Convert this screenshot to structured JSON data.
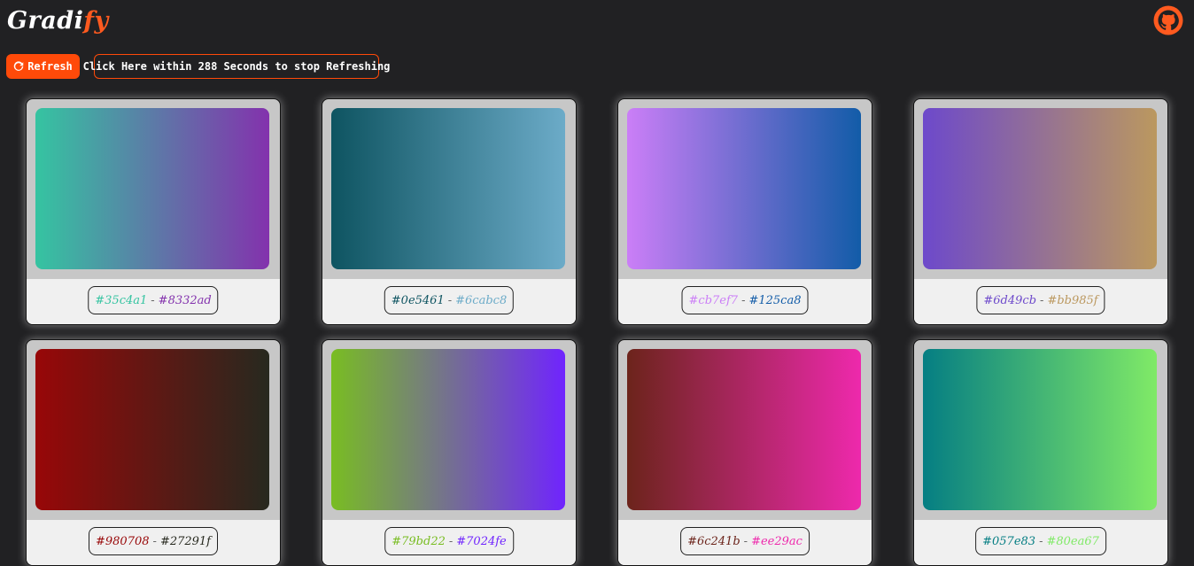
{
  "app": {
    "logo_part1": "Gradi",
    "logo_part2": "fy",
    "github_icon": "github-icon"
  },
  "toolbar": {
    "refresh_label": "Refresh",
    "timer_text": "Click Here within 288 Seconds to stop Refreshing"
  },
  "colors": {
    "accent": "#ff4a09",
    "background": "#212123",
    "card_frame": "#c7c7c7",
    "card_footer": "#f0f0f0"
  },
  "gradients": [
    {
      "from": "#35c4a1",
      "to": "#8332ad",
      "sep": "-"
    },
    {
      "from": "#0e5461",
      "to": "#6cabc8",
      "sep": "-"
    },
    {
      "from": "#cb7ef7",
      "to": "#125ca8",
      "sep": "-"
    },
    {
      "from": "#6d49cb",
      "to": "#bb985f",
      "sep": "-"
    },
    {
      "from": "#980708",
      "to": "#27291f",
      "sep": "-"
    },
    {
      "from": "#79bd22",
      "to": "#7024fe",
      "sep": "-"
    },
    {
      "from": "#6c241b",
      "to": "#ee29ac",
      "sep": "-"
    },
    {
      "from": "#057e83",
      "to": "#80ea67",
      "sep": "-"
    }
  ]
}
